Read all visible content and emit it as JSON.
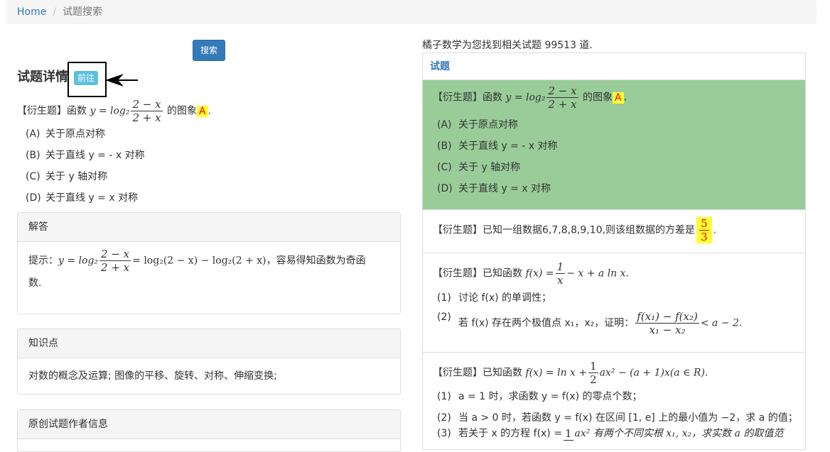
{
  "breadcrumb": {
    "home": "Home",
    "current": "试题搜索"
  },
  "search_button": "搜索",
  "detail": {
    "title": "试题详情",
    "goto_button": "前往",
    "stem_prefix": "【衍生题】函数",
    "stem_func": "y = log₂",
    "stem_num": "2 − x",
    "stem_den": "2 + x",
    "stem_suffix": "的图象",
    "answer": "A",
    "options": [
      {
        "key": "(A)",
        "text": "关于原点对称"
      },
      {
        "key": "(B)",
        "text": "关于直线 y = - x 对称"
      },
      {
        "key": "(C)",
        "text": "关于 y 轴对称"
      },
      {
        "key": "(D)",
        "text": "关于直线 y = x 对称"
      }
    ]
  },
  "solution": {
    "header": "解答",
    "hint_prefix": "提示：",
    "hint_func": "y = log₂",
    "hint_num": "2 − x",
    "hint_den": "2 + x",
    "hint_rest": "= log₂(2 − x) − log₂(2 + x)，容易得知函数为奇函",
    "hint_line2": "数."
  },
  "knowledge": {
    "header": "知识点",
    "content": "对数的概念及运算; 图像的平移、旋转、对称、伸缩变换;"
  },
  "author": {
    "header": "原创试题作者信息"
  },
  "results": {
    "count_text": "橘子数学为您找到相关试题 99513 道.",
    "header": "试题",
    "items": [
      {
        "prefix": "【衍生题】函数",
        "func": "y = log₂",
        "num": "2 − x",
        "den": "2 + x",
        "suffix": "的图象",
        "answer": "A",
        "options": [
          {
            "key": "(A)",
            "text": "关于原点对称"
          },
          {
            "key": "(B)",
            "text": "关于直线 y = - x 对称"
          },
          {
            "key": "(C)",
            "text": "关于 y 轴对称"
          },
          {
            "key": "(D)",
            "text": "关于直线 y = x 对称"
          }
        ]
      },
      {
        "text": "【衍生题】已知一组数据6,7,8,8,9,10,则该组数据的方差是",
        "ans_num": "5",
        "ans_den": "3"
      },
      {
        "prefix": "【衍生题】已知函数",
        "func": "f(x) =",
        "num": "1",
        "den": "x",
        "rest": "− x + a ln x.",
        "sub1_key": "(1)",
        "sub1": "讨论 f(x) 的单调性；",
        "sub2_key": "(2)",
        "sub2_pre": "若 f(x) 存在两个极值点 x₁，x₂，证明：",
        "sub2_num": "f(x₁) − f(x₂)",
        "sub2_den": "x₁ − x₂",
        "sub2_post": "< a − 2."
      },
      {
        "prefix": "【衍生题】已知函数",
        "func": "f(x) = ln x +",
        "num": "1",
        "den": "2",
        "rest": "ax² − (a + 1)x(a ∈ R).",
        "sub1_key": "(1)",
        "sub1": "a = 1 时，求函数 y = f(x) 的零点个数；",
        "sub2_key": "(2)",
        "sub2": "当 a > 0 时，若函数 y = f(x) 在区间 [1, e] 上的最小值为 −2，求 a 的值；",
        "sub3_key": "(3)",
        "sub3_pre": "若关于 x 的方程 f(x) =",
        "sub3_num": "1",
        "sub3_post": "ax² 有两个不同实根 x₁, x₂，求实数 a 的取值范"
      }
    ]
  }
}
